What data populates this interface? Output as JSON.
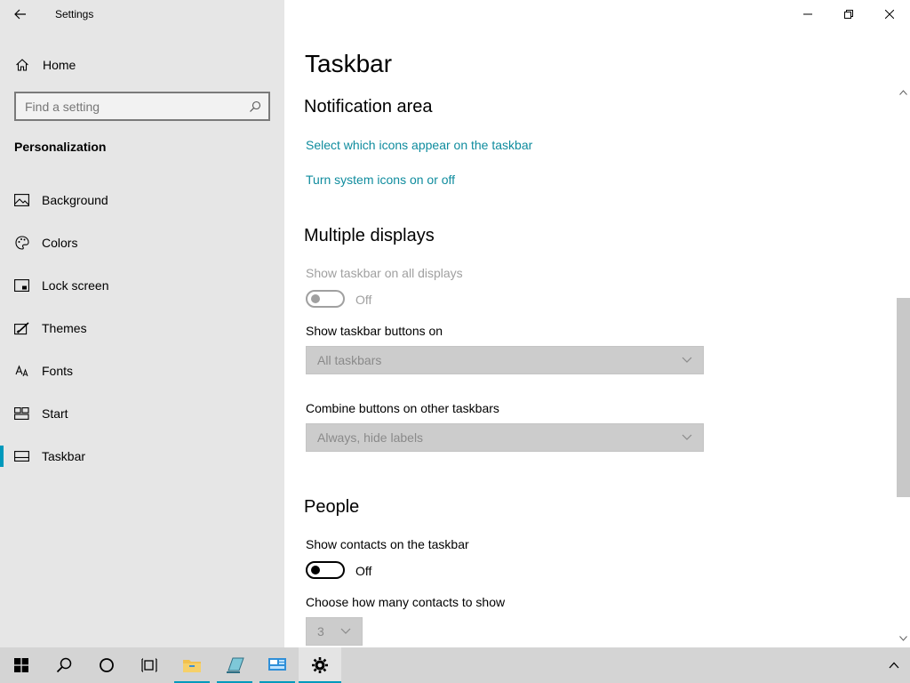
{
  "window": {
    "app_title": "Settings",
    "back_icon": "back-arrow-icon",
    "controls": [
      "minimize-icon",
      "restore-icon",
      "close-icon"
    ]
  },
  "sidebar": {
    "home_label": "Home",
    "search": {
      "placeholder": "Find a setting",
      "value": ""
    },
    "section_title": "Personalization",
    "items": [
      {
        "label": "Background",
        "icon": "picture-icon",
        "active": false
      },
      {
        "label": "Colors",
        "icon": "palette-icon",
        "active": false
      },
      {
        "label": "Lock screen",
        "icon": "lock-screen-icon",
        "active": false
      },
      {
        "label": "Themes",
        "icon": "brush-icon",
        "active": false
      },
      {
        "label": "Fonts",
        "icon": "fonts-icon",
        "active": false
      },
      {
        "label": "Start",
        "icon": "start-tiles-icon",
        "active": false
      },
      {
        "label": "Taskbar",
        "icon": "taskbar-icon",
        "active": true
      }
    ],
    "accent_color": "#0099bc"
  },
  "main": {
    "page_title": "Taskbar",
    "notification_area": {
      "heading": "Notification area",
      "link_icons": "Select which icons appear on the taskbar",
      "link_system": "Turn system icons on or off",
      "link_color": "#0f8c9e"
    },
    "multiple_displays": {
      "heading": "Multiple displays",
      "show_all_label": "Show taskbar on all displays",
      "show_all_state": "Off",
      "buttons_on_label": "Show taskbar buttons on",
      "buttons_on_value": "All taskbars",
      "combine_label": "Combine buttons on other taskbars",
      "combine_value": "Always, hide labels"
    },
    "people": {
      "heading": "People",
      "contacts_label": "Show contacts on the taskbar",
      "contacts_state": "Off",
      "count_label": "Choose how many contacts to show",
      "count_value": "3"
    }
  },
  "taskbar": {
    "buttons": [
      "windows-start-icon",
      "search-icon",
      "cortana-icon",
      "task-view-icon",
      "file-explorer-icon",
      "notepad-icon",
      "control-panel-icon",
      "settings-gear-icon"
    ],
    "tray": "chevron-up-icon"
  }
}
